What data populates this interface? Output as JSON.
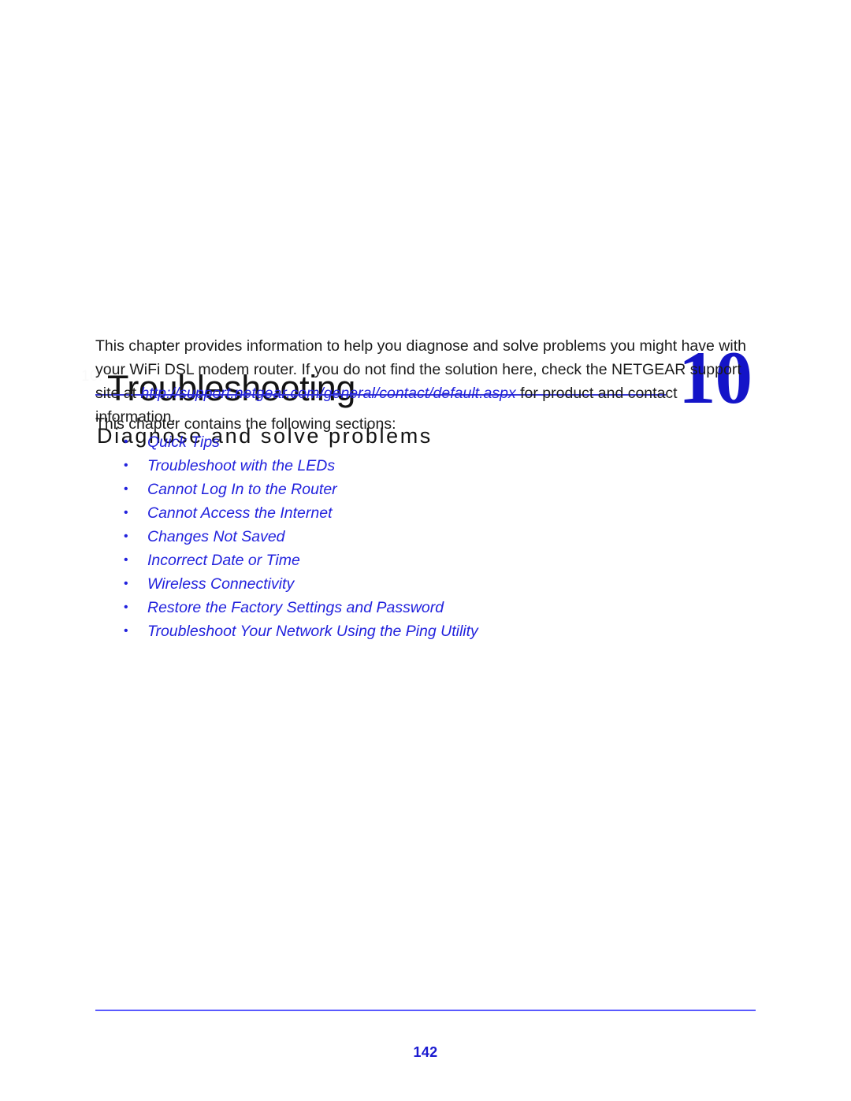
{
  "chapter": {
    "marker": "10.",
    "title": "Troubleshooting",
    "subtitle": "Diagnose and solve problems",
    "number": "10",
    "rule_color": "#3a3ad4",
    "number_color": "#1414c8"
  },
  "body": {
    "intro_before_link": "This chapter provides information to help you diagnose and solve problems you might have with your WiFi DSL modem router. If you do not find the solution here, check the NETGEAR support site at ",
    "intro_link": "http://support.netgear.com/general/contact/default.aspx",
    "intro_after_link": " for product and contact information.",
    "sections_lead": "This chapter contains the following sections:",
    "link_color": "#2222dd"
  },
  "sections": [
    {
      "bullet": "•",
      "label": "Quick Tips"
    },
    {
      "bullet": "•",
      "label": "Troubleshoot with the LEDs"
    },
    {
      "bullet": "•",
      "label": "Cannot Log In to the Router"
    },
    {
      "bullet": "•",
      "label": "Cannot Access the Internet"
    },
    {
      "bullet": "•",
      "label": "Changes Not Saved"
    },
    {
      "bullet": "•",
      "label": "Incorrect Date or Time"
    },
    {
      "bullet": "•",
      "label": "Wireless Connectivity"
    },
    {
      "bullet": "•",
      "label": "Restore the Factory Settings and Password"
    },
    {
      "bullet": "•",
      "label": "Troubleshoot Your Network Using the Ping Utility"
    }
  ],
  "footer": {
    "page_number": "142",
    "rule_color": "#5a5aff",
    "page_number_color": "#1a1ad0"
  }
}
